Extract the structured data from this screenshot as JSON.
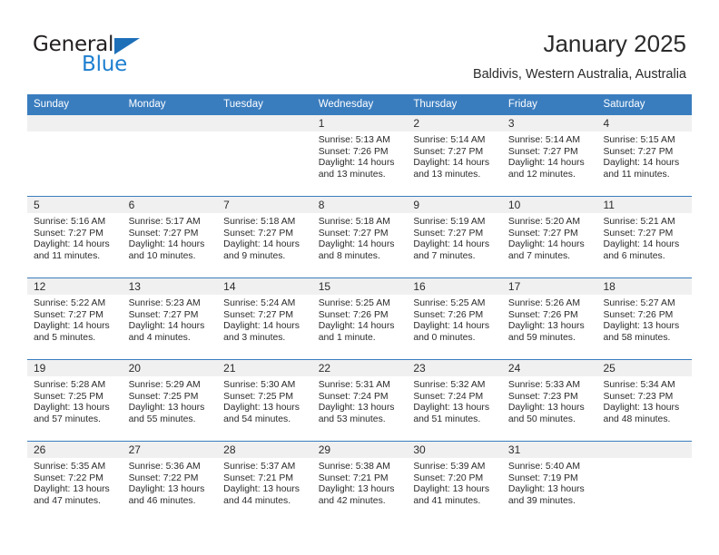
{
  "logo": {
    "word_general": "General",
    "word_blue": "Blue",
    "triangle_color": "#1d6fb8",
    "blue_color": "#1d7fd0"
  },
  "header": {
    "title": "January 2025",
    "subtitle": "Baldivis, Western Australia, Australia",
    "header_bg": "#3a7dbf"
  },
  "weekdays": [
    "Sunday",
    "Monday",
    "Tuesday",
    "Wednesday",
    "Thursday",
    "Friday",
    "Saturday"
  ],
  "weeks": [
    {
      "dates": [
        "",
        "",
        "",
        "1",
        "2",
        "3",
        "4"
      ],
      "cells": [
        {
          "empty": true,
          "sunrise": "",
          "sunset": "",
          "daylight1": "",
          "daylight2": ""
        },
        {
          "empty": true,
          "sunrise": "",
          "sunset": "",
          "daylight1": "",
          "daylight2": ""
        },
        {
          "empty": true,
          "sunrise": "",
          "sunset": "",
          "daylight1": "",
          "daylight2": ""
        },
        {
          "empty": false,
          "sunrise": "Sunrise: 5:13 AM",
          "sunset": "Sunset: 7:26 PM",
          "daylight1": "Daylight: 14 hours",
          "daylight2": "and 13 minutes."
        },
        {
          "empty": false,
          "sunrise": "Sunrise: 5:14 AM",
          "sunset": "Sunset: 7:27 PM",
          "daylight1": "Daylight: 14 hours",
          "daylight2": "and 13 minutes."
        },
        {
          "empty": false,
          "sunrise": "Sunrise: 5:14 AM",
          "sunset": "Sunset: 7:27 PM",
          "daylight1": "Daylight: 14 hours",
          "daylight2": "and 12 minutes."
        },
        {
          "empty": false,
          "sunrise": "Sunrise: 5:15 AM",
          "sunset": "Sunset: 7:27 PM",
          "daylight1": "Daylight: 14 hours",
          "daylight2": "and 11 minutes."
        }
      ]
    },
    {
      "dates": [
        "5",
        "6",
        "7",
        "8",
        "9",
        "10",
        "11"
      ],
      "cells": [
        {
          "empty": false,
          "sunrise": "Sunrise: 5:16 AM",
          "sunset": "Sunset: 7:27 PM",
          "daylight1": "Daylight: 14 hours",
          "daylight2": "and 11 minutes."
        },
        {
          "empty": false,
          "sunrise": "Sunrise: 5:17 AM",
          "sunset": "Sunset: 7:27 PM",
          "daylight1": "Daylight: 14 hours",
          "daylight2": "and 10 minutes."
        },
        {
          "empty": false,
          "sunrise": "Sunrise: 5:18 AM",
          "sunset": "Sunset: 7:27 PM",
          "daylight1": "Daylight: 14 hours",
          "daylight2": "and 9 minutes."
        },
        {
          "empty": false,
          "sunrise": "Sunrise: 5:18 AM",
          "sunset": "Sunset: 7:27 PM",
          "daylight1": "Daylight: 14 hours",
          "daylight2": "and 8 minutes."
        },
        {
          "empty": false,
          "sunrise": "Sunrise: 5:19 AM",
          "sunset": "Sunset: 7:27 PM",
          "daylight1": "Daylight: 14 hours",
          "daylight2": "and 7 minutes."
        },
        {
          "empty": false,
          "sunrise": "Sunrise: 5:20 AM",
          "sunset": "Sunset: 7:27 PM",
          "daylight1": "Daylight: 14 hours",
          "daylight2": "and 7 minutes."
        },
        {
          "empty": false,
          "sunrise": "Sunrise: 5:21 AM",
          "sunset": "Sunset: 7:27 PM",
          "daylight1": "Daylight: 14 hours",
          "daylight2": "and 6 minutes."
        }
      ]
    },
    {
      "dates": [
        "12",
        "13",
        "14",
        "15",
        "16",
        "17",
        "18"
      ],
      "cells": [
        {
          "empty": false,
          "sunrise": "Sunrise: 5:22 AM",
          "sunset": "Sunset: 7:27 PM",
          "daylight1": "Daylight: 14 hours",
          "daylight2": "and 5 minutes."
        },
        {
          "empty": false,
          "sunrise": "Sunrise: 5:23 AM",
          "sunset": "Sunset: 7:27 PM",
          "daylight1": "Daylight: 14 hours",
          "daylight2": "and 4 minutes."
        },
        {
          "empty": false,
          "sunrise": "Sunrise: 5:24 AM",
          "sunset": "Sunset: 7:27 PM",
          "daylight1": "Daylight: 14 hours",
          "daylight2": "and 3 minutes."
        },
        {
          "empty": false,
          "sunrise": "Sunrise: 5:25 AM",
          "sunset": "Sunset: 7:26 PM",
          "daylight1": "Daylight: 14 hours",
          "daylight2": "and 1 minute."
        },
        {
          "empty": false,
          "sunrise": "Sunrise: 5:25 AM",
          "sunset": "Sunset: 7:26 PM",
          "daylight1": "Daylight: 14 hours",
          "daylight2": "and 0 minutes."
        },
        {
          "empty": false,
          "sunrise": "Sunrise: 5:26 AM",
          "sunset": "Sunset: 7:26 PM",
          "daylight1": "Daylight: 13 hours",
          "daylight2": "and 59 minutes."
        },
        {
          "empty": false,
          "sunrise": "Sunrise: 5:27 AM",
          "sunset": "Sunset: 7:26 PM",
          "daylight1": "Daylight: 13 hours",
          "daylight2": "and 58 minutes."
        }
      ]
    },
    {
      "dates": [
        "19",
        "20",
        "21",
        "22",
        "23",
        "24",
        "25"
      ],
      "cells": [
        {
          "empty": false,
          "sunrise": "Sunrise: 5:28 AM",
          "sunset": "Sunset: 7:25 PM",
          "daylight1": "Daylight: 13 hours",
          "daylight2": "and 57 minutes."
        },
        {
          "empty": false,
          "sunrise": "Sunrise: 5:29 AM",
          "sunset": "Sunset: 7:25 PM",
          "daylight1": "Daylight: 13 hours",
          "daylight2": "and 55 minutes."
        },
        {
          "empty": false,
          "sunrise": "Sunrise: 5:30 AM",
          "sunset": "Sunset: 7:25 PM",
          "daylight1": "Daylight: 13 hours",
          "daylight2": "and 54 minutes."
        },
        {
          "empty": false,
          "sunrise": "Sunrise: 5:31 AM",
          "sunset": "Sunset: 7:24 PM",
          "daylight1": "Daylight: 13 hours",
          "daylight2": "and 53 minutes."
        },
        {
          "empty": false,
          "sunrise": "Sunrise: 5:32 AM",
          "sunset": "Sunset: 7:24 PM",
          "daylight1": "Daylight: 13 hours",
          "daylight2": "and 51 minutes."
        },
        {
          "empty": false,
          "sunrise": "Sunrise: 5:33 AM",
          "sunset": "Sunset: 7:23 PM",
          "daylight1": "Daylight: 13 hours",
          "daylight2": "and 50 minutes."
        },
        {
          "empty": false,
          "sunrise": "Sunrise: 5:34 AM",
          "sunset": "Sunset: 7:23 PM",
          "daylight1": "Daylight: 13 hours",
          "daylight2": "and 48 minutes."
        }
      ]
    },
    {
      "dates": [
        "26",
        "27",
        "28",
        "29",
        "30",
        "31",
        ""
      ],
      "cells": [
        {
          "empty": false,
          "sunrise": "Sunrise: 5:35 AM",
          "sunset": "Sunset: 7:22 PM",
          "daylight1": "Daylight: 13 hours",
          "daylight2": "and 47 minutes."
        },
        {
          "empty": false,
          "sunrise": "Sunrise: 5:36 AM",
          "sunset": "Sunset: 7:22 PM",
          "daylight1": "Daylight: 13 hours",
          "daylight2": "and 46 minutes."
        },
        {
          "empty": false,
          "sunrise": "Sunrise: 5:37 AM",
          "sunset": "Sunset: 7:21 PM",
          "daylight1": "Daylight: 13 hours",
          "daylight2": "and 44 minutes."
        },
        {
          "empty": false,
          "sunrise": "Sunrise: 5:38 AM",
          "sunset": "Sunset: 7:21 PM",
          "daylight1": "Daylight: 13 hours",
          "daylight2": "and 42 minutes."
        },
        {
          "empty": false,
          "sunrise": "Sunrise: 5:39 AM",
          "sunset": "Sunset: 7:20 PM",
          "daylight1": "Daylight: 13 hours",
          "daylight2": "and 41 minutes."
        },
        {
          "empty": false,
          "sunrise": "Sunrise: 5:40 AM",
          "sunset": "Sunset: 7:19 PM",
          "daylight1": "Daylight: 13 hours",
          "daylight2": "and 39 minutes."
        },
        {
          "empty": true,
          "sunrise": "",
          "sunset": "",
          "daylight1": "",
          "daylight2": ""
        }
      ]
    }
  ]
}
